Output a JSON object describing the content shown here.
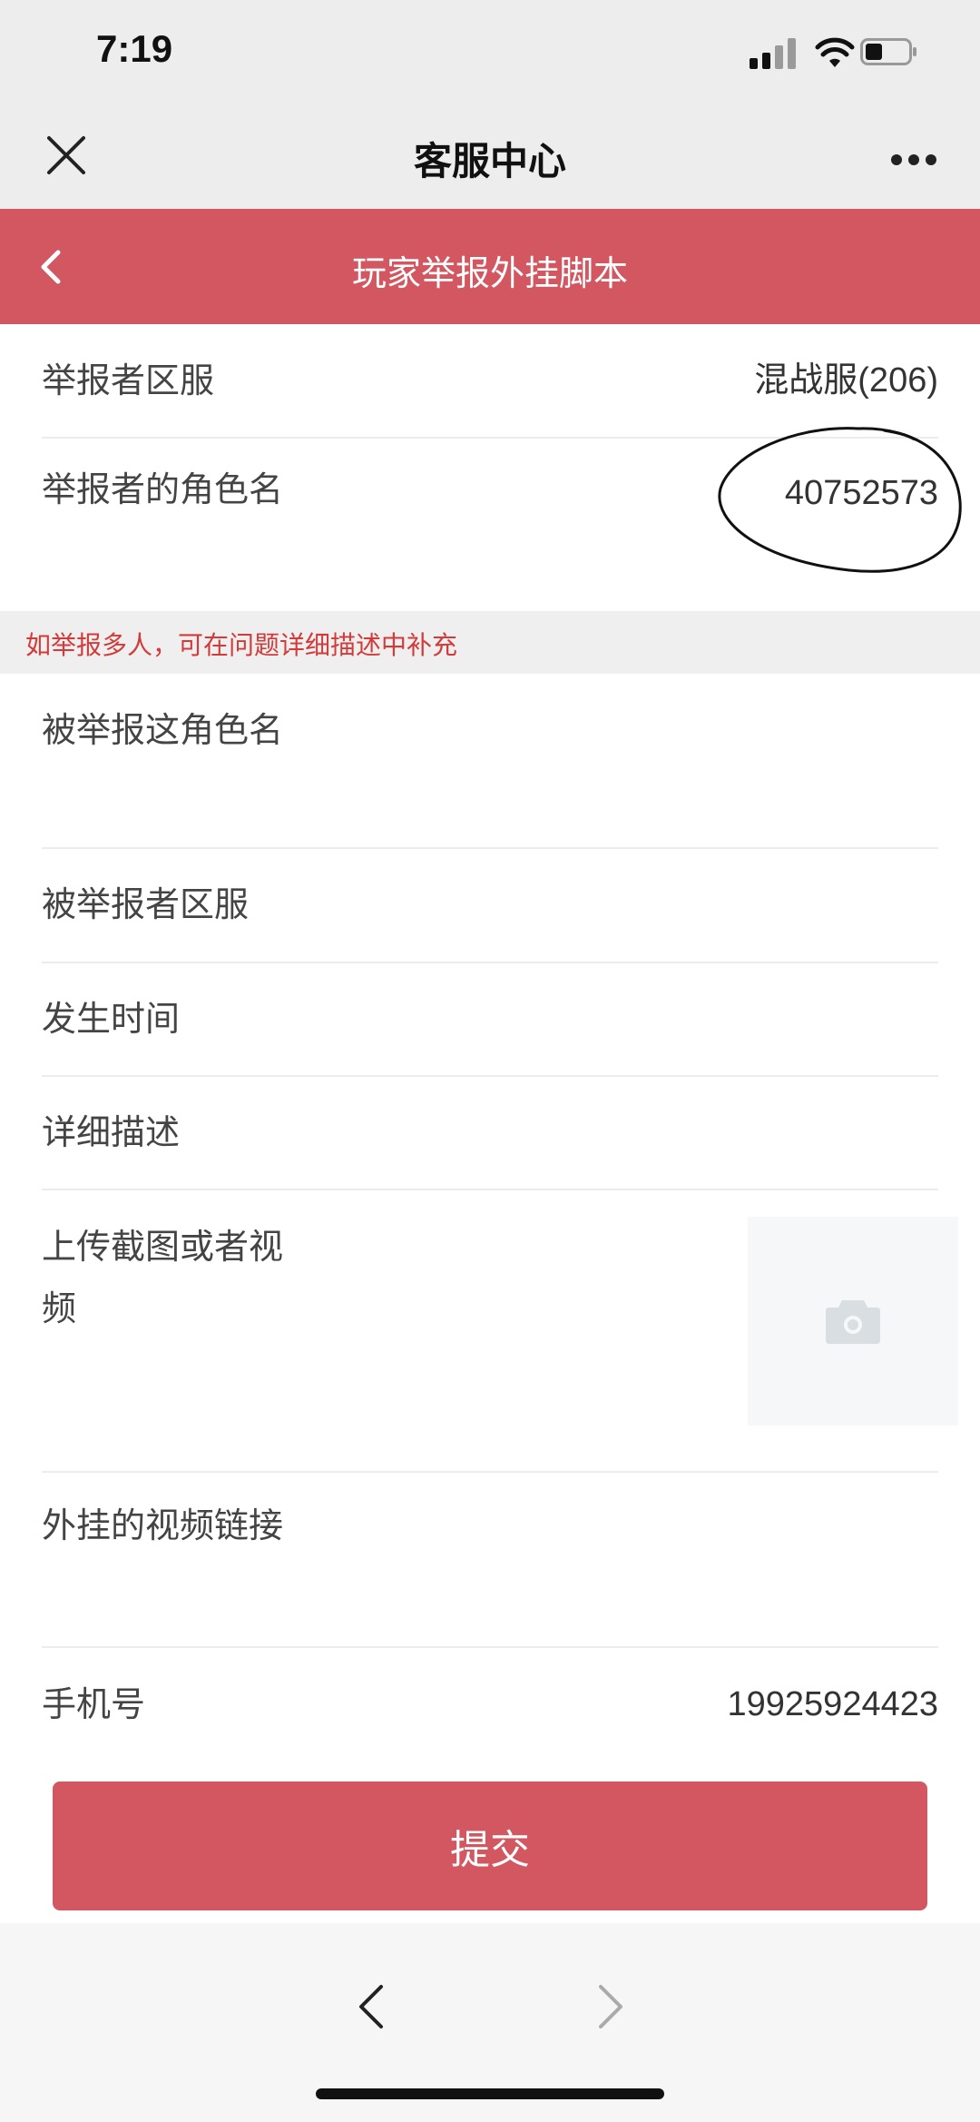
{
  "status_bar": {
    "time": "7:19",
    "icons": [
      "signal-icon",
      "wifi-icon",
      "battery-icon"
    ]
  },
  "top_nav": {
    "title": "客服中心",
    "close_icon": "close-icon",
    "more_icon": "more-icon"
  },
  "header": {
    "title": "玩家举报外挂脚本",
    "back_icon": "chevron-left-icon",
    "bg_color": "#d25761"
  },
  "form": {
    "reporter_server": {
      "label": "举报者区服",
      "value": "混战服(206)"
    },
    "reporter_role": {
      "label": "举报者的角色名",
      "value": "40752573"
    },
    "hint": "如举报多人，可在问题详细描述中补充",
    "reported_role": {
      "label": "被举报这角色名",
      "value": ""
    },
    "reported_server": {
      "label": "被举报者区服",
      "value": ""
    },
    "time": {
      "label": "发生时间",
      "value": ""
    },
    "description": {
      "label": "详细描述",
      "value": ""
    },
    "upload": {
      "label": "上传截图或者视频",
      "icon": "camera-icon"
    },
    "video_link": {
      "label": "外挂的视频链接",
      "value": ""
    },
    "phone": {
      "label": "手机号",
      "value": "19925924423"
    }
  },
  "submit": {
    "label": "提交",
    "color": "#d25761"
  },
  "bottom_bar": {
    "back_icon": "chevron-left-icon",
    "forward_icon": "chevron-right-icon"
  }
}
